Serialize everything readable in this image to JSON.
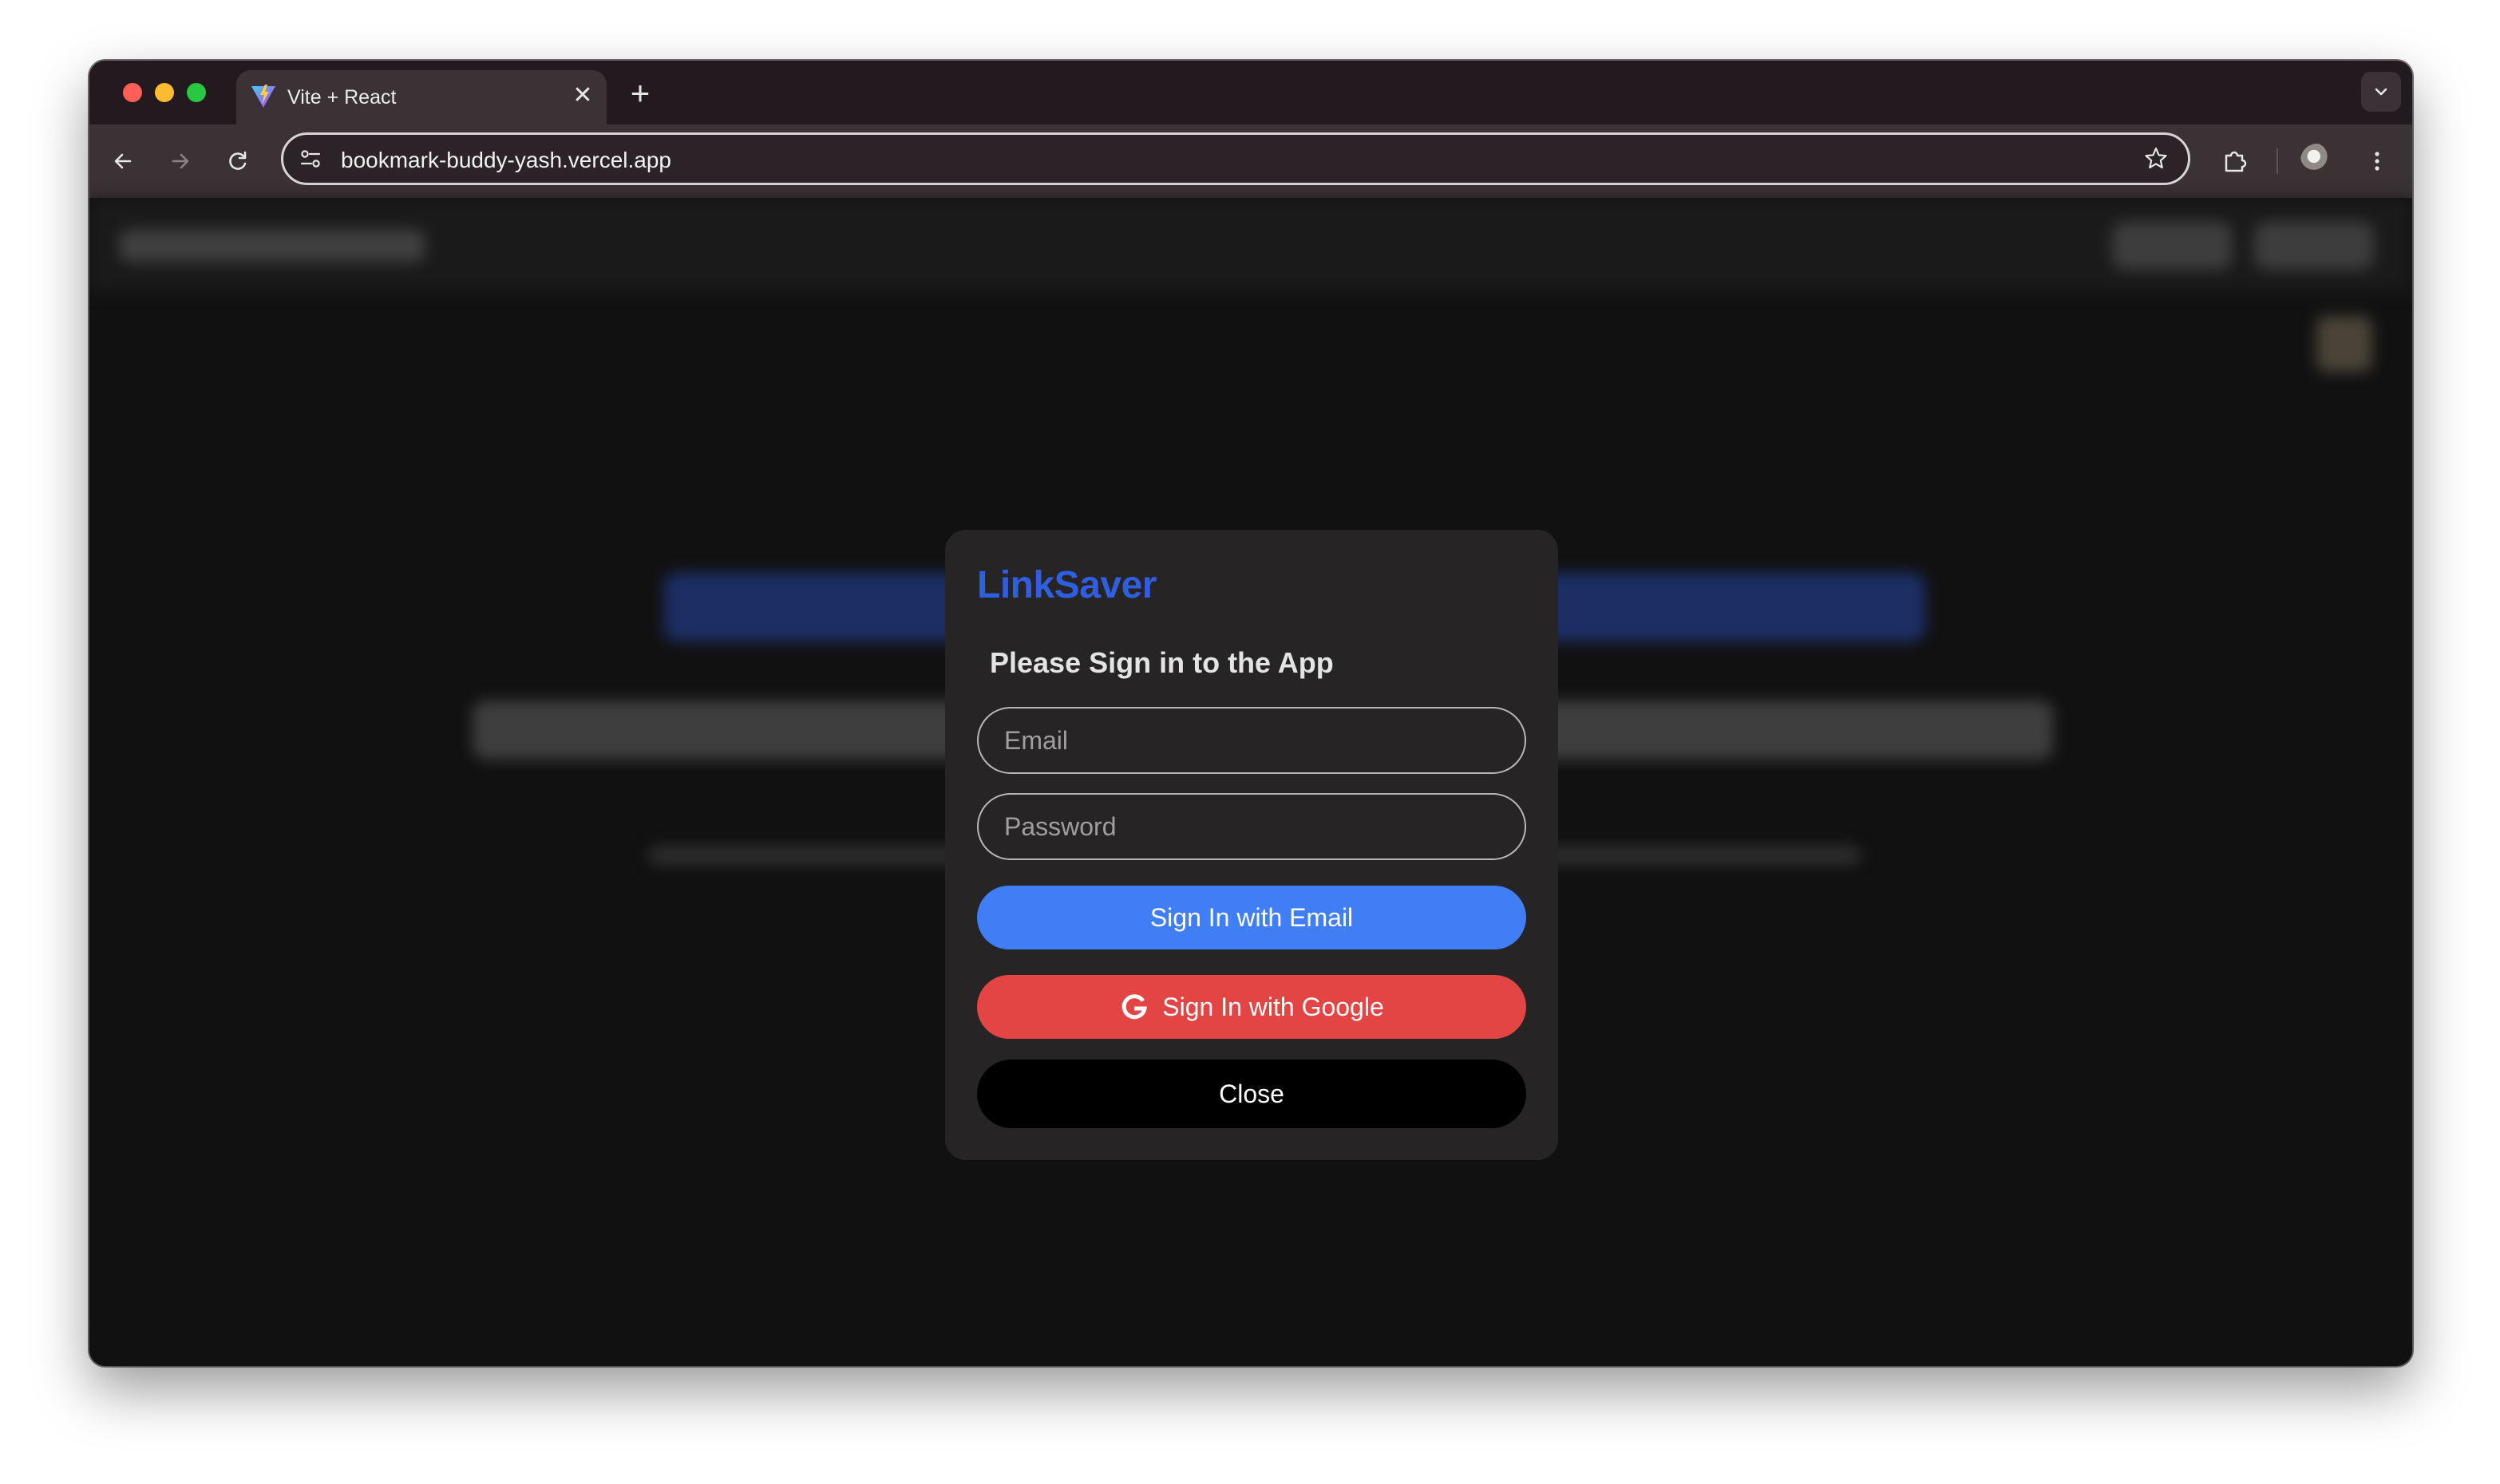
{
  "browser": {
    "tab": {
      "title": "Vite + React",
      "close_glyph": "✕"
    },
    "new_tab_glyph": "+",
    "address_bar": {
      "url": "bookmark-buddy-yash.vercel.app"
    },
    "icons": [
      "vite-favicon",
      "back-icon",
      "forward-icon",
      "reload-icon",
      "site-info-icon",
      "bookmark-star-icon",
      "extensions-icon",
      "profile-avatar",
      "menu-icon",
      "tab-search-icon"
    ]
  },
  "modal": {
    "brand": "LinkSaver",
    "heading": "Please Sign in to the App",
    "email_placeholder": "Email",
    "password_placeholder": "Password",
    "email_button_label": "Sign In with Email",
    "google_button_label": "Sign In with Google",
    "close_button_label": "Close"
  },
  "colors": {
    "brand": "#2f5fe0",
    "email_button": "#3f7ef5",
    "google_button": "#e34545",
    "close_button": "#000000",
    "modal_background": "#262424",
    "page_background": "#121112"
  }
}
